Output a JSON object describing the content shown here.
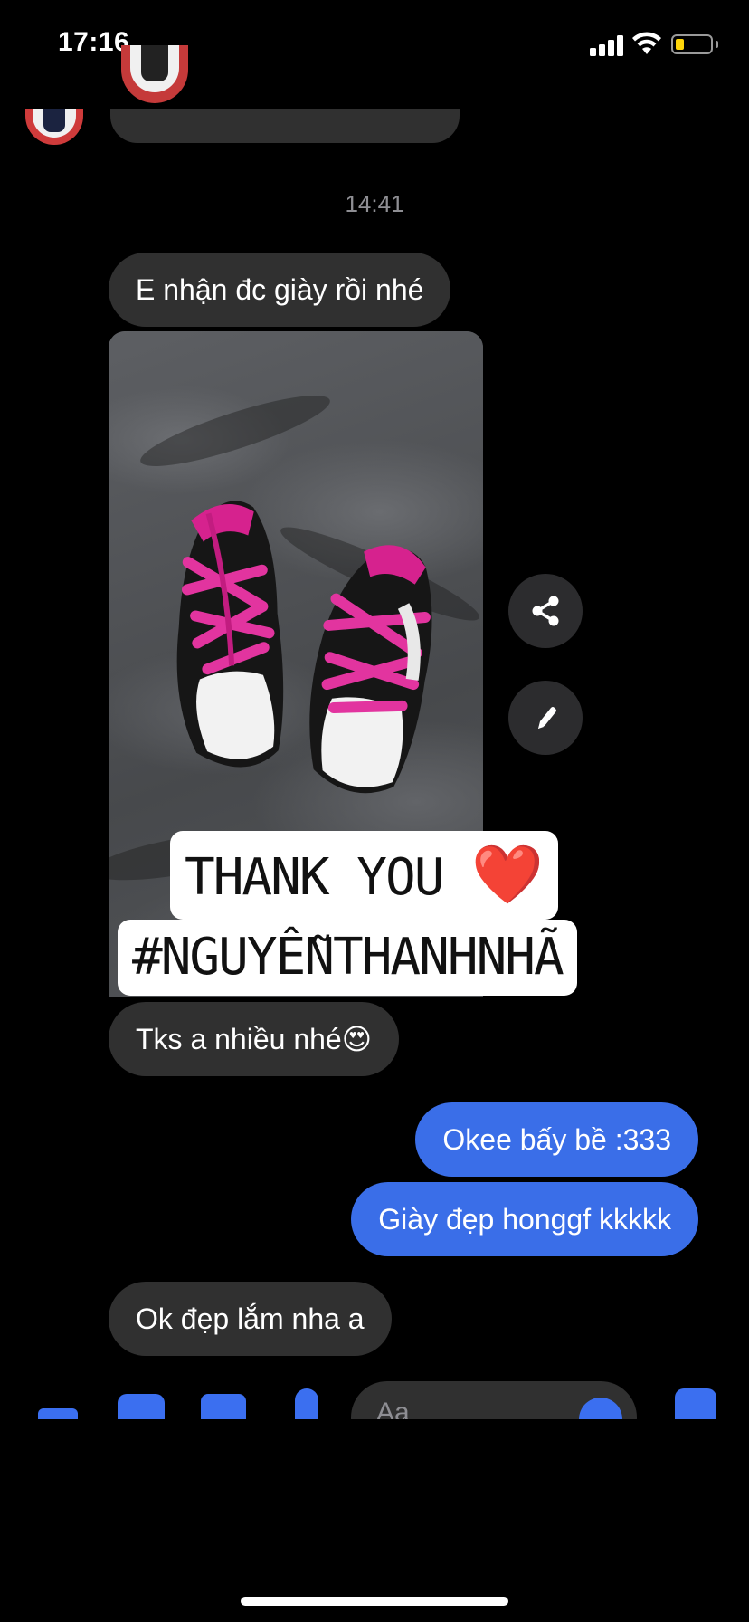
{
  "status_bar": {
    "time": "17:16",
    "battery_level": 0.15,
    "battery_color": "#ffd60a"
  },
  "conversation": {
    "timestamp": "14:41",
    "messages": [
      {
        "from": "them",
        "text": "E nhận đc giày rồi nhé"
      },
      {
        "from": "them",
        "type": "image",
        "sticker_line1": "THANK YOU",
        "sticker_heart": "❤️",
        "sticker_line2": "#NGUYỄNTHANHNHÃ"
      },
      {
        "from": "them",
        "text": "Tks a nhiều nhé😍"
      },
      {
        "from": "me",
        "text": "Okee bấy bề :333"
      },
      {
        "from": "me",
        "text": "Giày đẹp honggf kkkkk"
      },
      {
        "from": "them",
        "text": "Ok đẹp lắm nha a"
      }
    ]
  },
  "image_actions": {
    "share_icon": "share-icon",
    "edit_icon": "pencil-icon"
  },
  "composer": {
    "placeholder": "Aa",
    "icons": [
      "more-icon",
      "camera-icon",
      "gallery-icon",
      "mic-icon",
      "emoji-icon",
      "like-icon"
    ]
  },
  "colors": {
    "incoming_bubble": "#303030",
    "outgoing_bubble": "#3a6ee8",
    "accent": "#3b6ff0"
  }
}
